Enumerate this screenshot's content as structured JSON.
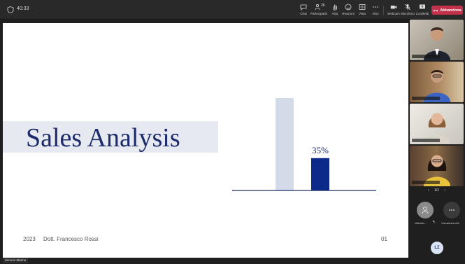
{
  "meeting": {
    "timer": "40:33",
    "toolbar": {
      "chat_label": "Chat",
      "people_label": "Partecipanti",
      "people_count": "26",
      "raise_label": "Alza",
      "react_label": "Reazioni",
      "view_label": "Vista",
      "more_label": "Altro",
      "camera_label": "Webcam",
      "mic_label": "Microfono",
      "share_label": "Condividi",
      "leave_label": "Abbandona"
    },
    "presenter_label": "Simone Marino"
  },
  "slide": {
    "title": "Sales Analysis",
    "year": "2023",
    "author": "Dott. Francesco Rossi",
    "page": "01"
  },
  "chart_data": {
    "type": "bar",
    "categories": [
      "",
      ""
    ],
    "values": [
      100,
      35
    ],
    "data_labels": [
      "",
      "35%"
    ],
    "colors": [
      "#d3dbe8",
      "#0b2a8a"
    ],
    "ylim": [
      0,
      100
    ],
    "title": "",
    "xlabel": "",
    "ylabel": "",
    "grid": false
  },
  "participants": {
    "pager": "1/2",
    "attendee_label": "Valentin…",
    "more_label": "Visualizza tutti",
    "me_initials": "LZ"
  }
}
